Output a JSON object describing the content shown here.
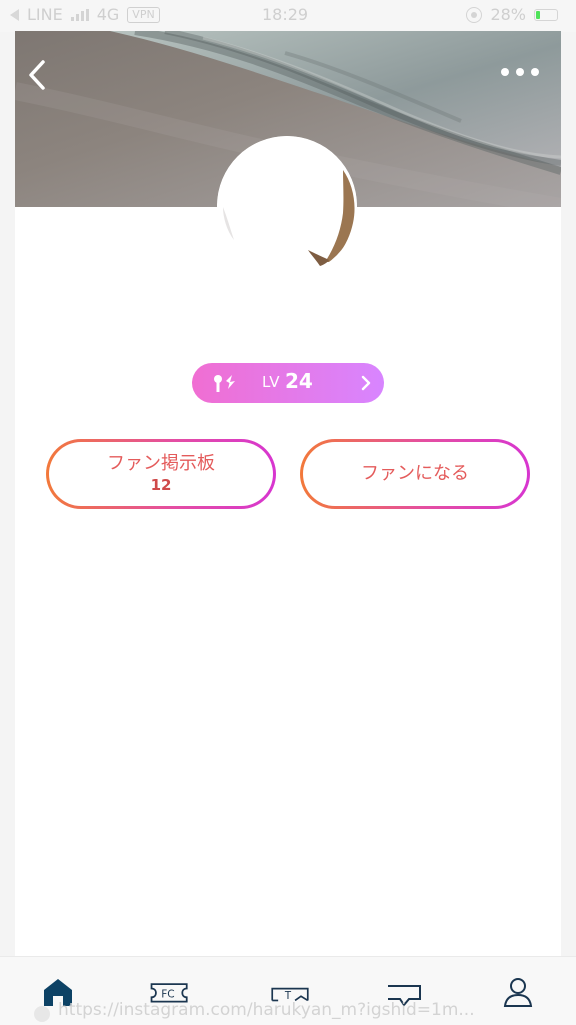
{
  "status_bar": {
    "carrier": "LINE",
    "network": "4G",
    "vpn": "VPN",
    "time": "18:29",
    "battery": "28%"
  },
  "icons": {
    "back": "back-icon",
    "more": "more-icon",
    "home": "home-icon",
    "fc": "fc-icon",
    "t": "t-icon",
    "chat": "chat-icon",
    "user": "user-icon"
  },
  "level": {
    "label": "LV",
    "value": "24"
  },
  "actions": {
    "board_label": "ファン掲示板",
    "board_count": "12",
    "become_fan_label": "ファンになる"
  },
  "tabbar": {
    "fc_label": "FC",
    "t_label": "T"
  },
  "bottom": {
    "url_text": "https://instagram.com/harukyan_m?igshid=1m..."
  },
  "colors": {
    "accent_pink": "#f06ed2",
    "accent_purple": "#d885ff",
    "button_orange": "#f2793a",
    "button_magenta": "#d735d0",
    "active_tab": "#0d4265"
  }
}
